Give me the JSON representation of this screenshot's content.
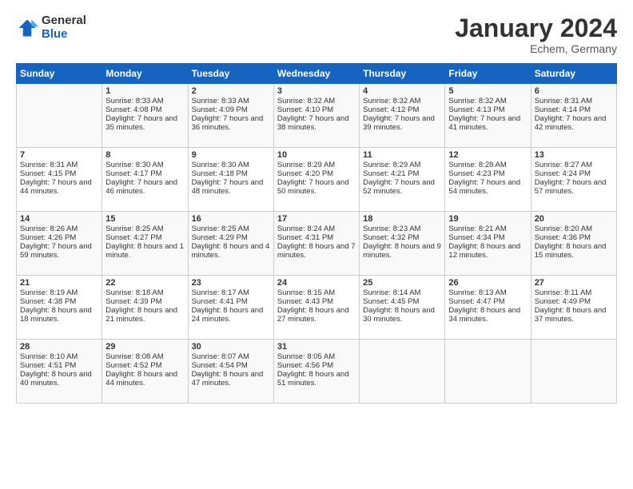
{
  "header": {
    "logo_general": "General",
    "logo_blue": "Blue",
    "title": "January 2024",
    "subtitle": "Echem, Germany"
  },
  "days_of_week": [
    "Sunday",
    "Monday",
    "Tuesday",
    "Wednesday",
    "Thursday",
    "Friday",
    "Saturday"
  ],
  "weeks": [
    [
      {
        "day": "",
        "sunrise": "",
        "sunset": "",
        "daylight": ""
      },
      {
        "day": "1",
        "sunrise": "Sunrise: 8:33 AM",
        "sunset": "Sunset: 4:08 PM",
        "daylight": "Daylight: 7 hours and 35 minutes."
      },
      {
        "day": "2",
        "sunrise": "Sunrise: 8:33 AM",
        "sunset": "Sunset: 4:09 PM",
        "daylight": "Daylight: 7 hours and 36 minutes."
      },
      {
        "day": "3",
        "sunrise": "Sunrise: 8:32 AM",
        "sunset": "Sunset: 4:10 PM",
        "daylight": "Daylight: 7 hours and 38 minutes."
      },
      {
        "day": "4",
        "sunrise": "Sunrise: 8:32 AM",
        "sunset": "Sunset: 4:12 PM",
        "daylight": "Daylight: 7 hours and 39 minutes."
      },
      {
        "day": "5",
        "sunrise": "Sunrise: 8:32 AM",
        "sunset": "Sunset: 4:13 PM",
        "daylight": "Daylight: 7 hours and 41 minutes."
      },
      {
        "day": "6",
        "sunrise": "Sunrise: 8:31 AM",
        "sunset": "Sunset: 4:14 PM",
        "daylight": "Daylight: 7 hours and 42 minutes."
      }
    ],
    [
      {
        "day": "7",
        "sunrise": "Sunrise: 8:31 AM",
        "sunset": "Sunset: 4:15 PM",
        "daylight": "Daylight: 7 hours and 44 minutes."
      },
      {
        "day": "8",
        "sunrise": "Sunrise: 8:30 AM",
        "sunset": "Sunset: 4:17 PM",
        "daylight": "Daylight: 7 hours and 46 minutes."
      },
      {
        "day": "9",
        "sunrise": "Sunrise: 8:30 AM",
        "sunset": "Sunset: 4:18 PM",
        "daylight": "Daylight: 7 hours and 48 minutes."
      },
      {
        "day": "10",
        "sunrise": "Sunrise: 8:29 AM",
        "sunset": "Sunset: 4:20 PM",
        "daylight": "Daylight: 7 hours and 50 minutes."
      },
      {
        "day": "11",
        "sunrise": "Sunrise: 8:29 AM",
        "sunset": "Sunset: 4:21 PM",
        "daylight": "Daylight: 7 hours and 52 minutes."
      },
      {
        "day": "12",
        "sunrise": "Sunrise: 8:28 AM",
        "sunset": "Sunset: 4:23 PM",
        "daylight": "Daylight: 7 hours and 54 minutes."
      },
      {
        "day": "13",
        "sunrise": "Sunrise: 8:27 AM",
        "sunset": "Sunset: 4:24 PM",
        "daylight": "Daylight: 7 hours and 57 minutes."
      }
    ],
    [
      {
        "day": "14",
        "sunrise": "Sunrise: 8:26 AM",
        "sunset": "Sunset: 4:26 PM",
        "daylight": "Daylight: 7 hours and 59 minutes."
      },
      {
        "day": "15",
        "sunrise": "Sunrise: 8:25 AM",
        "sunset": "Sunset: 4:27 PM",
        "daylight": "Daylight: 8 hours and 1 minute."
      },
      {
        "day": "16",
        "sunrise": "Sunrise: 8:25 AM",
        "sunset": "Sunset: 4:29 PM",
        "daylight": "Daylight: 8 hours and 4 minutes."
      },
      {
        "day": "17",
        "sunrise": "Sunrise: 8:24 AM",
        "sunset": "Sunset: 4:31 PM",
        "daylight": "Daylight: 8 hours and 7 minutes."
      },
      {
        "day": "18",
        "sunrise": "Sunrise: 8:23 AM",
        "sunset": "Sunset: 4:32 PM",
        "daylight": "Daylight: 8 hours and 9 minutes."
      },
      {
        "day": "19",
        "sunrise": "Sunrise: 8:21 AM",
        "sunset": "Sunset: 4:34 PM",
        "daylight": "Daylight: 8 hours and 12 minutes."
      },
      {
        "day": "20",
        "sunrise": "Sunrise: 8:20 AM",
        "sunset": "Sunset: 4:36 PM",
        "daylight": "Daylight: 8 hours and 15 minutes."
      }
    ],
    [
      {
        "day": "21",
        "sunrise": "Sunrise: 8:19 AM",
        "sunset": "Sunset: 4:38 PM",
        "daylight": "Daylight: 8 hours and 18 minutes."
      },
      {
        "day": "22",
        "sunrise": "Sunrise: 8:18 AM",
        "sunset": "Sunset: 4:39 PM",
        "daylight": "Daylight: 8 hours and 21 minutes."
      },
      {
        "day": "23",
        "sunrise": "Sunrise: 8:17 AM",
        "sunset": "Sunset: 4:41 PM",
        "daylight": "Daylight: 8 hours and 24 minutes."
      },
      {
        "day": "24",
        "sunrise": "Sunrise: 8:15 AM",
        "sunset": "Sunset: 4:43 PM",
        "daylight": "Daylight: 8 hours and 27 minutes."
      },
      {
        "day": "25",
        "sunrise": "Sunrise: 8:14 AM",
        "sunset": "Sunset: 4:45 PM",
        "daylight": "Daylight: 8 hours and 30 minutes."
      },
      {
        "day": "26",
        "sunrise": "Sunrise: 8:13 AM",
        "sunset": "Sunset: 4:47 PM",
        "daylight": "Daylight: 8 hours and 34 minutes."
      },
      {
        "day": "27",
        "sunrise": "Sunrise: 8:11 AM",
        "sunset": "Sunset: 4:49 PM",
        "daylight": "Daylight: 8 hours and 37 minutes."
      }
    ],
    [
      {
        "day": "28",
        "sunrise": "Sunrise: 8:10 AM",
        "sunset": "Sunset: 4:51 PM",
        "daylight": "Daylight: 8 hours and 40 minutes."
      },
      {
        "day": "29",
        "sunrise": "Sunrise: 8:08 AM",
        "sunset": "Sunset: 4:52 PM",
        "daylight": "Daylight: 8 hours and 44 minutes."
      },
      {
        "day": "30",
        "sunrise": "Sunrise: 8:07 AM",
        "sunset": "Sunset: 4:54 PM",
        "daylight": "Daylight: 8 hours and 47 minutes."
      },
      {
        "day": "31",
        "sunrise": "Sunrise: 8:05 AM",
        "sunset": "Sunset: 4:56 PM",
        "daylight": "Daylight: 8 hours and 51 minutes."
      },
      {
        "day": "",
        "sunrise": "",
        "sunset": "",
        "daylight": ""
      },
      {
        "day": "",
        "sunrise": "",
        "sunset": "",
        "daylight": ""
      },
      {
        "day": "",
        "sunrise": "",
        "sunset": "",
        "daylight": ""
      }
    ]
  ]
}
